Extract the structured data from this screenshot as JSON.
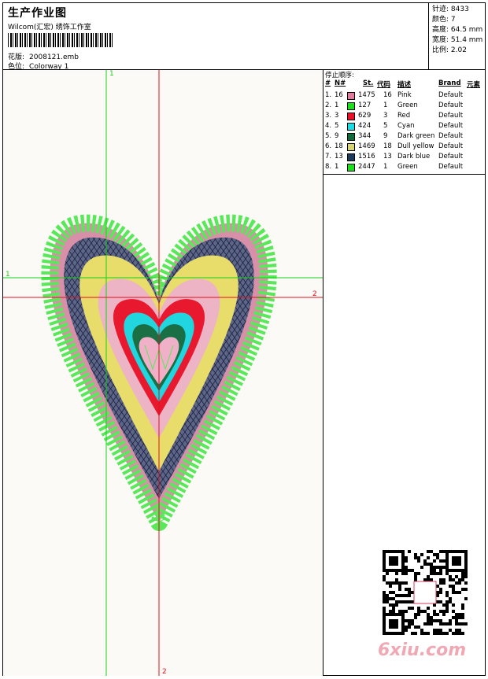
{
  "header": {
    "title": "生产作业图",
    "subtitle": "Wilcom(汇宏) 绣饰工作室",
    "design_label": "花版:",
    "design_value": "2008121.emb",
    "colorway_label": "色位:",
    "colorway_value": "Colorway 1"
  },
  "stats": {
    "stitches": "针迹: 8433",
    "colors": "颜色: 7",
    "height": "高度: 64.5 mm",
    "width": "宽度: 51.4 mm",
    "scale": "比例: 2.02"
  },
  "guides": {
    "v1_label": "1",
    "h1_label": "1",
    "h2_label": "2",
    "v2_label": "2"
  },
  "legend": {
    "stop_order": "停止顺序:",
    "headers": {
      "num": "#",
      "needle": "N#",
      "st": "St.",
      "code": "代码",
      "desc": "描述",
      "brand": "Brand",
      "element": "元素"
    },
    "rows": [
      {
        "idx": "1.",
        "needle": "16",
        "color": "#e07a9e",
        "st": "1475",
        "code": "16",
        "desc": "Pink",
        "brand": "Default"
      },
      {
        "idx": "2.",
        "needle": "1",
        "color": "#19e019",
        "st": "127",
        "code": "1",
        "desc": "Green",
        "brand": "Default"
      },
      {
        "idx": "3.",
        "needle": "3",
        "color": "#e8102a",
        "st": "629",
        "code": "3",
        "desc": "Red",
        "brand": "Default"
      },
      {
        "idx": "4.",
        "needle": "5",
        "color": "#16e0e6",
        "st": "424",
        "code": "5",
        "desc": "Cyan",
        "brand": "Default"
      },
      {
        "idx": "5.",
        "needle": "9",
        "color": "#0f6a3a",
        "st": "344",
        "code": "9",
        "desc": "Dark green",
        "brand": "Default"
      },
      {
        "idx": "6.",
        "needle": "18",
        "color": "#d8d470",
        "st": "1469",
        "code": "18",
        "desc": "Dull yellow",
        "brand": "Default"
      },
      {
        "idx": "7.",
        "needle": "13",
        "color": "#1c3a5a",
        "st": "1516",
        "code": "13",
        "desc": "Dark blue",
        "brand": "Default"
      },
      {
        "idx": "8.",
        "needle": "1",
        "color": "#19e019",
        "st": "2447",
        "code": "1",
        "desc": "Green",
        "brand": "Default"
      }
    ]
  },
  "watermark": "6xiu.com",
  "colors": {
    "guide_green": "#19d019",
    "guide_red": "#e01020"
  }
}
